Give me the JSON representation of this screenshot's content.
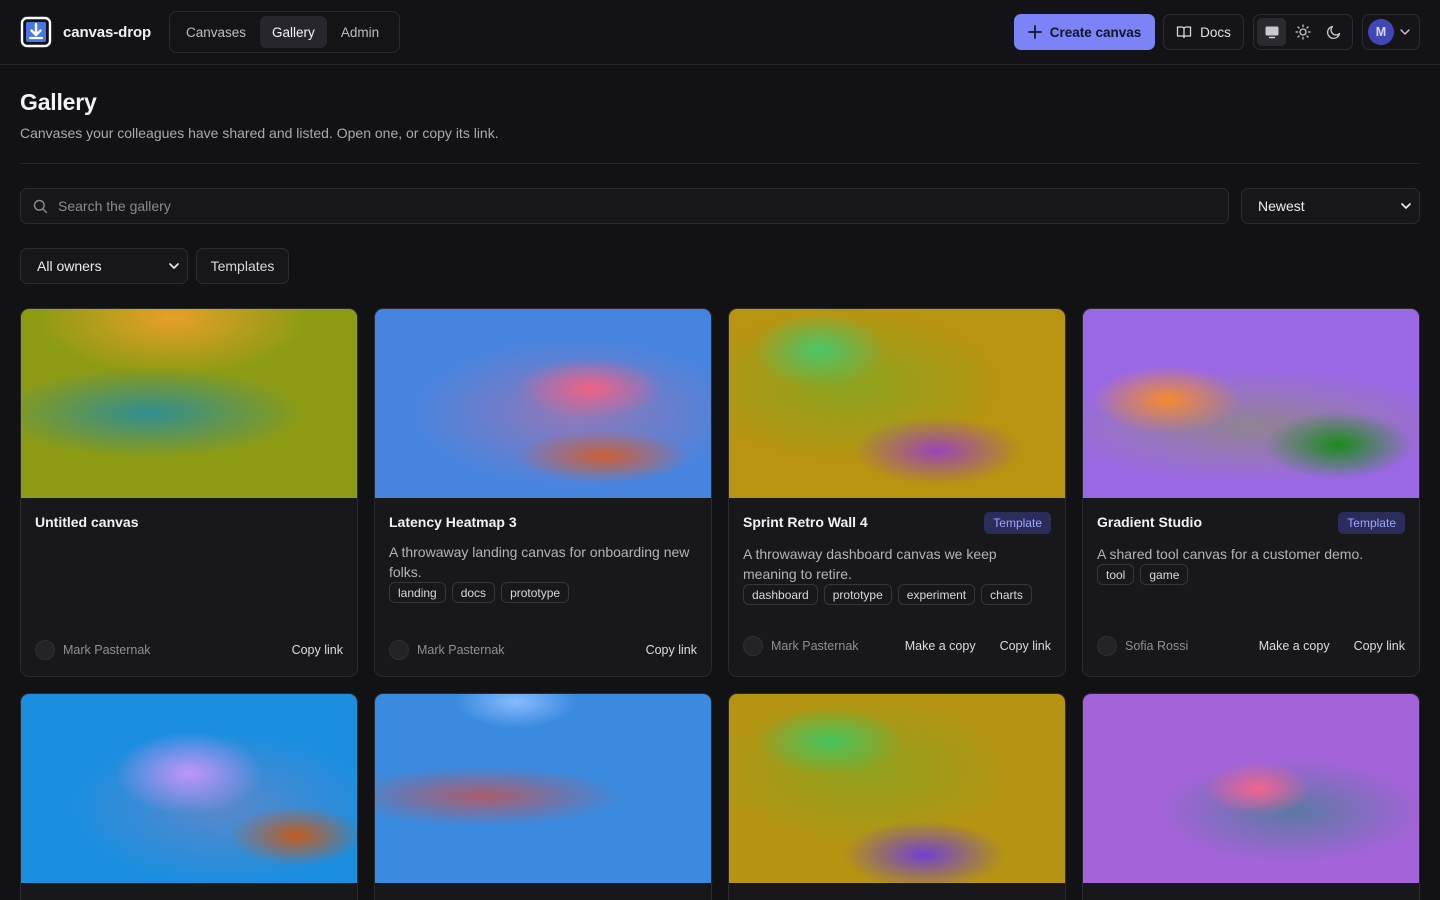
{
  "app": {
    "name": "canvas-drop"
  },
  "nav": {
    "tabs": [
      "Canvases",
      "Gallery",
      "Admin"
    ],
    "active": "Gallery"
  },
  "header": {
    "create_label": "Create canvas",
    "docs_label": "Docs",
    "user_initial": "M"
  },
  "page": {
    "title": "Gallery",
    "subtitle": "Canvases your colleagues have shared and listed. Open one, or copy its link."
  },
  "filters": {
    "search_placeholder": "Search the gallery",
    "sort_value": "Newest",
    "owner_value": "All owners",
    "templates_label": "Templates"
  },
  "cards": [
    {
      "title": "Untitled canvas",
      "badge": "",
      "description": "",
      "tags": [],
      "owner": "Mark Pasternak",
      "actions": [
        "Copy link"
      ]
    },
    {
      "title": "Latency Heatmap 3",
      "badge": "",
      "description": "A throwaway landing canvas for onboarding new folks.",
      "tags": [
        "landing",
        "docs",
        "prototype"
      ],
      "owner": "Mark Pasternak",
      "actions": [
        "Copy link"
      ]
    },
    {
      "title": "Sprint Retro Wall 4",
      "badge": "Template",
      "description": "A throwaway dashboard canvas we keep meaning to retire.",
      "tags": [
        "dashboard",
        "prototype",
        "experiment",
        "charts"
      ],
      "owner": "Mark Pasternak",
      "actions": [
        "Make a copy",
        "Copy link"
      ]
    },
    {
      "title": "Gradient Studio",
      "badge": "Template",
      "description": "A shared tool canvas for a customer demo.",
      "tags": [
        "tool",
        "game"
      ],
      "owner": "Sofia Rossi",
      "actions": [
        "Make a copy",
        "Copy link"
      ]
    }
  ],
  "colors": {
    "accent": "#7b83f6",
    "background": "#121214",
    "badge_bg": "#2a2d5a",
    "badge_text": "#9fa4ff"
  }
}
